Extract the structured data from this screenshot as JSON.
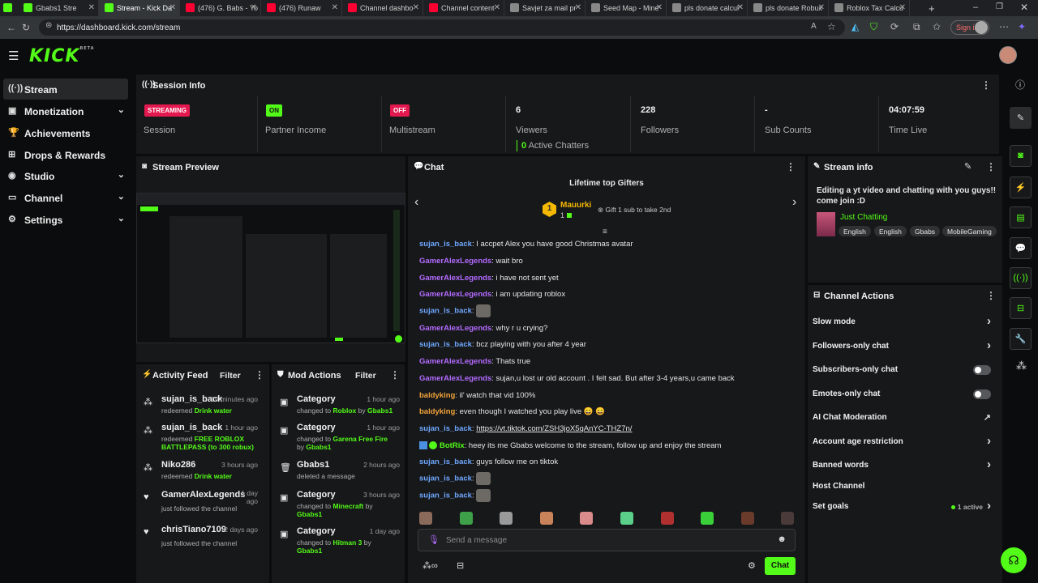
{
  "browser": {
    "tabs": [
      {
        "title": "Gbabs1 Stre",
        "color": "#53fc18"
      },
      {
        "title": "Stream - Kick Da",
        "color": "#53fc18"
      },
      {
        "title": "(476) G. Babs - Yo",
        "color": "#ff0033"
      },
      {
        "title": "(476) Runaw",
        "color": "#ff0033"
      },
      {
        "title": "Channel dashbo",
        "color": "#ff0033"
      },
      {
        "title": "Channel content",
        "color": "#ff0033"
      },
      {
        "title": "Savjet za mail pr",
        "color": "#888888"
      },
      {
        "title": "Seed Map - Mine",
        "color": "#888888"
      },
      {
        "title": "pls donate calcul",
        "color": "#888888"
      },
      {
        "title": "pls donate Robux",
        "color": "#888888"
      },
      {
        "title": "Roblox Tax Calcu",
        "color": "#888888"
      }
    ],
    "url": "https://dashboard.kick.com/stream",
    "signin": "Sign in"
  },
  "app": {
    "logo": "KICK",
    "beta": "BETA"
  },
  "sidebar": {
    "items": [
      {
        "label": "Stream",
        "icon": "stream-icon",
        "glyph": "((·))",
        "chevron": false
      },
      {
        "label": "Monetization",
        "icon": "money-icon",
        "glyph": "▣",
        "chevron": true
      },
      {
        "label": "Achievements",
        "icon": "trophy-icon",
        "glyph": "🏆",
        "chevron": false
      },
      {
        "label": "Drops & Rewards",
        "icon": "gift-icon",
        "glyph": "⊞",
        "chevron": false
      },
      {
        "label": "Studio",
        "icon": "studio-icon",
        "glyph": "◉",
        "chevron": true
      },
      {
        "label": "Channel",
        "icon": "channel-icon",
        "glyph": "▭",
        "chevron": true
      },
      {
        "label": "Settings",
        "icon": "gear-icon",
        "glyph": "⚙",
        "chevron": true
      }
    ]
  },
  "session": {
    "title": "Session Info",
    "cells": [
      {
        "badge": "STREAMING",
        "badge_color": "#e3184e",
        "label": "Session"
      },
      {
        "badge": "ON",
        "badge_color": "#53fc18",
        "label": "Partner Income"
      },
      {
        "badge": "OFF",
        "badge_color": "#e3184e",
        "label": "Multistream"
      },
      {
        "value": "6",
        "label": "Viewers"
      },
      {
        "value": "228",
        "label": "Followers"
      },
      {
        "value": "-",
        "label": "Sub Counts"
      },
      {
        "value": "04:07:59",
        "label": "Time Live"
      }
    ],
    "active_chatters_count": "0",
    "active_chatters_label": "Active Chatters"
  },
  "preview": {
    "title": "Stream Preview"
  },
  "activity": {
    "title": "Activity Feed",
    "filter": "Filter",
    "items": [
      {
        "user": "sujan_is_back",
        "time": "19 minutes ago",
        "action": "redeemed",
        "detail": "Drink water",
        "icon": "reward-icon",
        "glyph": "⁂"
      },
      {
        "user": "sujan_is_back",
        "time": "1 hour ago",
        "action": "redeemed",
        "detail": "FREE ROBLOX BATTLEPASS (to 300 robux)",
        "icon": "reward-icon",
        "glyph": "⁂"
      },
      {
        "user": "Niko286",
        "time": "3 hours ago",
        "action": "redeemed",
        "detail": "Drink water",
        "icon": "reward-icon",
        "glyph": "⁂"
      },
      {
        "user": "GamerAlexLegends",
        "time": "1 day ago",
        "action": "just followed the channel",
        "detail": "",
        "icon": "heart-icon",
        "glyph": "♥"
      },
      {
        "user": "chrisTiano7109",
        "time": "2 days ago",
        "action": "just followed the channel",
        "detail": "",
        "icon": "heart-icon",
        "glyph": "♥"
      }
    ]
  },
  "mod": {
    "title": "Mod Actions",
    "filter": "Filter",
    "items": [
      {
        "title": "Category",
        "time": "1 hour ago",
        "pre": "changed to",
        "target": "Roblox",
        "by": "by",
        "who": "Gbabs1",
        "icon": "category-icon",
        "glyph": "▣"
      },
      {
        "title": "Category",
        "time": "1 hour ago",
        "pre": "changed to",
        "target": "Garena Free Fire",
        "by": "by",
        "who": "Gbabs1",
        "icon": "category-icon",
        "glyph": "▣"
      },
      {
        "title": "Gbabs1",
        "time": "2 hours ago",
        "pre": "deleted a message",
        "target": "",
        "by": "",
        "who": "",
        "icon": "trash-icon",
        "glyph": "🗑"
      },
      {
        "title": "Category",
        "time": "3 hours ago",
        "pre": "changed to",
        "target": "Minecraft",
        "by": "by",
        "who": "Gbabs1",
        "icon": "category-icon",
        "glyph": "▣"
      },
      {
        "title": "Category",
        "time": "1 day ago",
        "pre": "changed to",
        "target": "Hitman 3",
        "by": "by",
        "who": "Gbabs1",
        "icon": "category-icon",
        "glyph": "▣"
      }
    ]
  },
  "chat": {
    "title": "Chat",
    "gifters_title": "Lifetime top Gifters",
    "top_gifter": {
      "name": "Mauurki",
      "count": "1",
      "rank": "1"
    },
    "gift_hint": "Gift 1 sub to take 2nd",
    "messages": [
      {
        "user": "sujan_is_back",
        "cls": "u-blue",
        "text": "I accpet Alex you have good Christmas avatar",
        "emote": false
      },
      {
        "user": "GamerAlexLegends",
        "cls": "u-purple",
        "text": "wait bro",
        "emote": false
      },
      {
        "user": "GamerAlexLegends",
        "cls": "u-purple",
        "text": "i have not sent yet",
        "emote": false
      },
      {
        "user": "GamerAlexLegends",
        "cls": "u-purple",
        "text": "i am updating roblox",
        "emote": false
      },
      {
        "user": "sujan_is_back",
        "cls": "u-blue",
        "text": "",
        "emote": true
      },
      {
        "user": "GamerAlexLegends",
        "cls": "u-purple",
        "text": "why r u crying?",
        "emote": false
      },
      {
        "user": "sujan_is_back",
        "cls": "u-blue",
        "text": "bcz playing with you after 4 year",
        "emote": false
      },
      {
        "user": "GamerAlexLegends",
        "cls": "u-purple",
        "text": "Thats true",
        "emote": false
      },
      {
        "user": "GamerAlexLegends",
        "cls": "u-purple",
        "text": "sujan,u lost ur old account . I felt sad. But after 3-4 years,u came back",
        "emote": false
      },
      {
        "user": "baldyking",
        "cls": "u-orange",
        "text": "il' watch that vid 100%",
        "emote": false
      },
      {
        "user": "baldyking",
        "cls": "u-orange",
        "text": "even though I watched you play live 😄 😄",
        "emote": false
      },
      {
        "user": "sujan_is_back",
        "cls": "u-blue",
        "text": "https://vt.tiktok.com/ZSH3joX5qAnYC-THZ7n/",
        "emote": false,
        "link": true
      },
      {
        "user": "BotRix",
        "cls": "u-green",
        "text": "heey its me Gbabs welcome to the stream, follow up and enjoy the stream",
        "emote": false,
        "bot": true
      },
      {
        "user": "sujan_is_back",
        "cls": "u-blue",
        "text": "guys follow me on tiktok",
        "emote": false
      },
      {
        "user": "sujan_is_back",
        "cls": "u-blue",
        "text": "",
        "emote": true
      },
      {
        "user": "sujan_is_back",
        "cls": "u-blue",
        "text": "",
        "emote": true
      }
    ],
    "emote_colors": [
      "#8a6b5a",
      "#3fa04a",
      "#9a9a9a",
      "#c9835a",
      "#d98a8a",
      "#5ad08a",
      "#b03030",
      "#3ad03a",
      "#6a3a2a",
      "#4a3a3a"
    ],
    "placeholder": "Send a message",
    "send": "Chat"
  },
  "stream_info": {
    "title": "Stream info",
    "text": "Editing a yt video and chatting with you guys!! come join :D",
    "category": "Just Chatting",
    "tags": [
      "English",
      "English",
      "Gbabs",
      "MobileGaming"
    ]
  },
  "channel_actions": {
    "title": "Channel Actions",
    "rows": [
      {
        "label": "Slow mode",
        "kind": "arrow"
      },
      {
        "label": "Followers-only chat",
        "kind": "arrow"
      },
      {
        "label": "Subscribers-only chat",
        "kind": "toggle"
      },
      {
        "label": "Emotes-only chat",
        "kind": "toggle"
      },
      {
        "label": "AI Chat Moderation",
        "kind": "ext"
      },
      {
        "label": "Account age restriction",
        "kind": "arrow"
      },
      {
        "label": "Banned words",
        "kind": "arrow"
      },
      {
        "label": "Host Channel",
        "kind": "none"
      },
      {
        "label": "Set goals",
        "kind": "active",
        "extra": "1 active"
      }
    ]
  },
  "rightbar": [
    "info-icon",
    "pencil-icon",
    "camera-icon",
    "bolt-icon",
    "note-icon",
    "chat-icon",
    "broadcast-icon",
    "gift-icon",
    "wrench-icon",
    "apps-icon"
  ]
}
